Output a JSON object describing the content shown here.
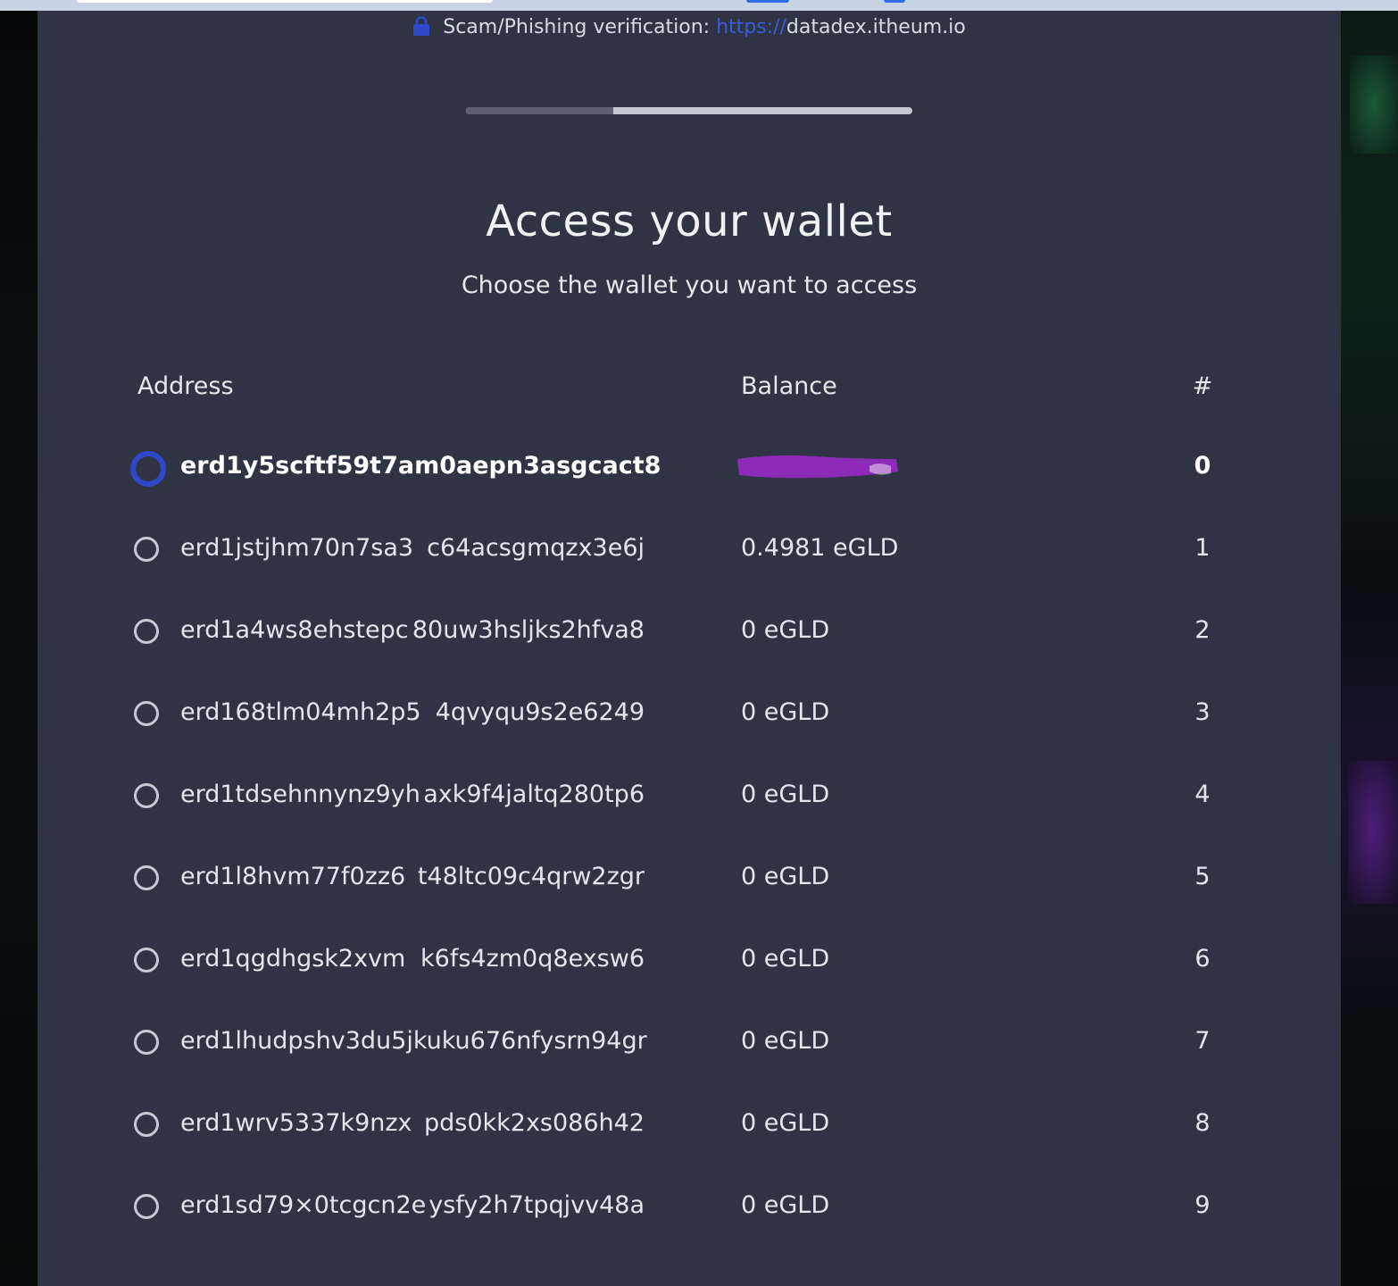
{
  "verification": {
    "label": "Scam/Phishing verification:",
    "url_scheme": "https://",
    "url_host": "datadex.itheum.io"
  },
  "progress": {
    "value": 0.33
  },
  "page": {
    "title": "Access your wallet",
    "subtitle": "Choose the wallet you want to access"
  },
  "table": {
    "headers": {
      "address": "Address",
      "balance": "Balance",
      "index": "#"
    },
    "rows": [
      {
        "addr_start": "erd1y5scftf59t7a",
        "addr_end": "m0aepn3asgcact8",
        "balance": "",
        "index": "0",
        "selected": true,
        "balance_redacted": true
      },
      {
        "addr_start": "erd1jstjhm70n7sa3",
        "addr_end": "c64acsgmqzx3e6j",
        "balance": "0.4981 eGLD",
        "index": "1"
      },
      {
        "addr_start": "erd1a4ws8ehstepc",
        "addr_end": "80uw3hsljks2hfva8",
        "balance": "0 eGLD",
        "index": "2"
      },
      {
        "addr_start": "erd168tlm04mh2p5",
        "addr_end": "4qvyqu9s2e6249",
        "balance": "0 eGLD",
        "index": "3"
      },
      {
        "addr_start": "erd1tdsehnnynz9yh",
        "addr_end": "axk9f4jaltq280tp6",
        "balance": "0 eGLD",
        "index": "4"
      },
      {
        "addr_start": "erd1l8hvm77f0zz6",
        "addr_end": "t48ltc09c4qrw2zgr",
        "balance": "0 eGLD",
        "index": "5"
      },
      {
        "addr_start": "erd1qgdhgsk2xvm",
        "addr_end": "k6fs4zm0q8exsw6",
        "balance": "0 eGLD",
        "index": "6"
      },
      {
        "addr_start": "erd1lhudpshv3du5j",
        "addr_end": "kuku676nfysrn94gr",
        "balance": "0 eGLD",
        "index": "7"
      },
      {
        "addr_start": "erd1wrv5337k9nzx",
        "addr_end": "pds0kk2xs086h42",
        "balance": "0 eGLD",
        "index": "8"
      },
      {
        "addr_start": "erd1sd79×0tcgcn2e",
        "addr_end": "ysfy2h7tpqjvv48a",
        "balance": "0 eGLD",
        "index": "9"
      }
    ]
  },
  "colors": {
    "modal_bg": "#2e3444",
    "accent_blue": "#2f48c9",
    "link_blue": "#3b5bdb",
    "redaction_purple": "#8e2ab8",
    "text": "#e3e6ec"
  },
  "icons": {
    "lock": "lock-icon",
    "radio": "radio-button",
    "redaction": "redaction-mark"
  }
}
